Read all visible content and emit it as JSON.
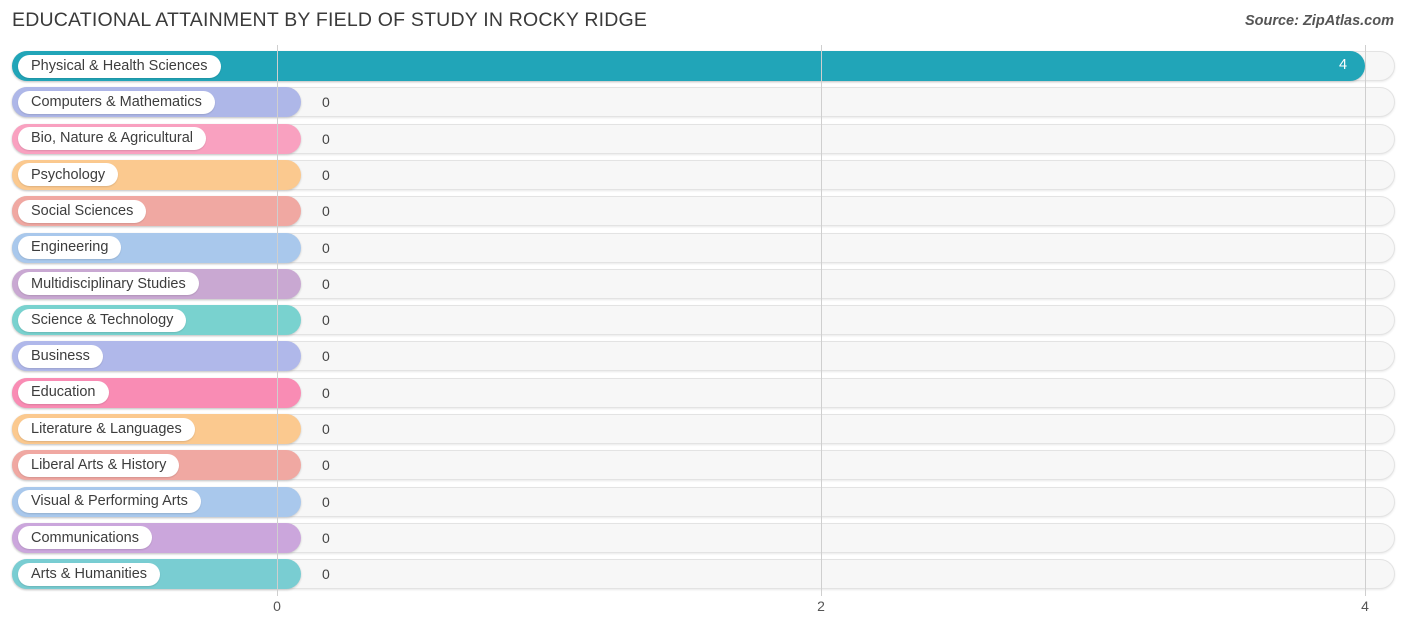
{
  "header": {
    "title": "EDUCATIONAL ATTAINMENT BY FIELD OF STUDY IN ROCKY RIDGE",
    "source": "Source: ZipAtlas.com"
  },
  "chart_data": {
    "type": "bar",
    "orientation": "horizontal",
    "title": "EDUCATIONAL ATTAINMENT BY FIELD OF STUDY IN ROCKY RIDGE",
    "xlabel": "",
    "ylabel": "",
    "xlim": [
      0,
      4
    ],
    "grid": true,
    "legend": "none",
    "ticks": [
      {
        "label": "0",
        "value": 0
      },
      {
        "label": "2",
        "value": 2
      },
      {
        "label": "4",
        "value": 4
      }
    ],
    "categories": [
      "Physical & Health Sciences",
      "Computers & Mathematics",
      "Bio, Nature & Agricultural",
      "Psychology",
      "Social Sciences",
      "Engineering",
      "Multidisciplinary Studies",
      "Science & Technology",
      "Business",
      "Education",
      "Literature & Languages",
      "Liberal Arts & History",
      "Visual & Performing Arts",
      "Communications",
      "Arts & Humanities"
    ],
    "values": [
      4,
      0,
      0,
      0,
      0,
      0,
      0,
      0,
      0,
      0,
      0,
      0,
      0,
      0,
      0
    ],
    "value_labels": [
      "4",
      "0",
      "0",
      "0",
      "0",
      "0",
      "0",
      "0",
      "0",
      "0",
      "0",
      "0",
      "0",
      "0",
      "0"
    ],
    "colors": [
      "#21a5b8",
      "#aeb7e8",
      "#f9a1c0",
      "#fbc98f",
      "#f0a8a2",
      "#a9c8ec",
      "#c9a8d2",
      "#79d2cf",
      "#b0b8ea",
      "#f98cb4",
      "#fbc98f",
      "#f0a8a2",
      "#a9c8ec",
      "#cba6dc",
      "#79cdd2"
    ]
  }
}
